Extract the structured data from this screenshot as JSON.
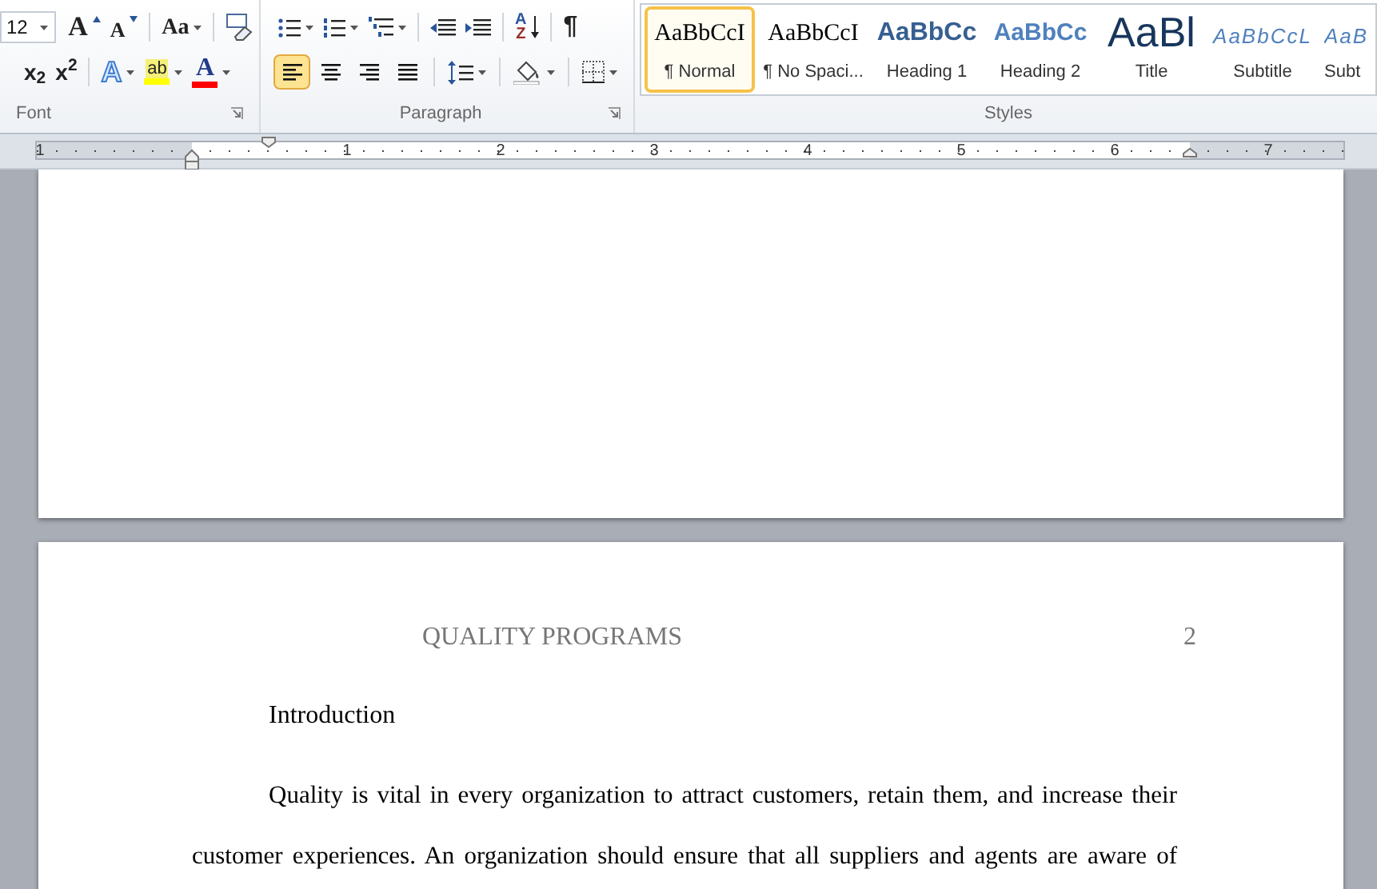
{
  "ribbon": {
    "font_group": {
      "label": "Font",
      "font_size": "12",
      "row1": [
        {
          "kind": "grow_font",
          "label": "A"
        },
        {
          "kind": "shrink_font",
          "label": "A"
        },
        {
          "kind": "change_case",
          "label": "Aa"
        },
        {
          "kind": "clear_format"
        }
      ],
      "row2": [
        {
          "kind": "subscript",
          "label": "x$_{2}$"
        },
        {
          "kind": "superscript",
          "label": "x$^{2}$"
        },
        {
          "kind": "text_effects",
          "label": "A"
        },
        {
          "kind": "highlight",
          "label": "ab"
        },
        {
          "kind": "font_color",
          "label": "A"
        }
      ]
    },
    "paragraph_group": {
      "label": "Paragraph",
      "row1": [
        {
          "kind": "bullets"
        },
        {
          "kind": "numbering"
        },
        {
          "kind": "multilevel"
        },
        {
          "kind": "decrease_indent"
        },
        {
          "kind": "increase_indent"
        },
        {
          "kind": "sort",
          "label": "A",
          "label2": "Z"
        },
        {
          "kind": "pilcrow",
          "label": "¶"
        }
      ],
      "alignment": [
        {
          "kind": "left",
          "selected": true
        },
        {
          "kind": "center",
          "selected": false
        },
        {
          "kind": "right",
          "selected": false
        },
        {
          "kind": "justify",
          "selected": false
        }
      ],
      "row2": [
        {
          "kind": "line_spacing"
        },
        {
          "kind": "shading"
        },
        {
          "kind": "borders"
        }
      ]
    },
    "styles_group": {
      "label": "Styles",
      "styles": [
        {
          "preview": "AaBbCcI",
          "name": "¶ Normal",
          "kind": "normal",
          "selected": true
        },
        {
          "preview": "AaBbCcI",
          "name": "¶ No Spaci...",
          "kind": "normal",
          "selected": false
        },
        {
          "preview": "AaBbCc",
          "name": "Heading 1",
          "kind": "heading1",
          "selected": false
        },
        {
          "preview": "AaBbCc",
          "name": "Heading 2",
          "kind": "heading2",
          "selected": false
        },
        {
          "preview": "AaBl",
          "name": "Title",
          "kind": "title",
          "selected": false
        },
        {
          "preview": "AaBbCcL",
          "name": "Subtitle",
          "kind": "subtitle",
          "selected": false
        },
        {
          "preview": "AaB",
          "name": "Subt",
          "kind": "subtitle",
          "selected": false
        }
      ]
    }
  },
  "ruler": {
    "numbers": [
      "1",
      "1",
      "2",
      "3",
      "4",
      "5",
      "6",
      "7"
    ]
  },
  "page_2": {
    "header": "QUALITY PROGRAMS",
    "page_number": "2",
    "heading": "Introduction",
    "paragraph": "Quality is vital in every organization to attract customers, retain them, and increase their customer experiences. An organization should ensure that all suppliers and agents are aware of"
  }
}
